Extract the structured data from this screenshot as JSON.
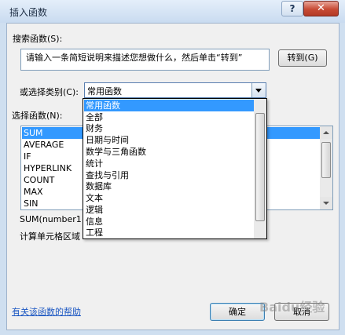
{
  "window": {
    "title": "插入函数",
    "help_label": "?",
    "close_label": "✕"
  },
  "search": {
    "label": "搜索函数(S):",
    "value": "请输入一条简短说明来描述您想做什么，然后单击“转到”",
    "go_button": "转到(G)"
  },
  "category": {
    "label": "或选择类别(C):",
    "selected": "常用函数",
    "options": [
      "常用函数",
      "全部",
      "财务",
      "日期与时间",
      "数学与三角函数",
      "统计",
      "查找与引用",
      "数据库",
      "文本",
      "逻辑",
      "信息",
      "工程"
    ]
  },
  "functions": {
    "label": "选择函数(N):",
    "items": [
      "SUM",
      "AVERAGE",
      "IF",
      "HYPERLINK",
      "COUNT",
      "MAX",
      "SIN"
    ],
    "selected_index": 0
  },
  "details": {
    "syntax": "SUM(number1",
    "description": "计算单元格区域"
  },
  "footer": {
    "help_link": "有关该函数的帮助",
    "ok_button": "确定",
    "cancel_button": "取消"
  },
  "watermark": "Baidu经验"
}
